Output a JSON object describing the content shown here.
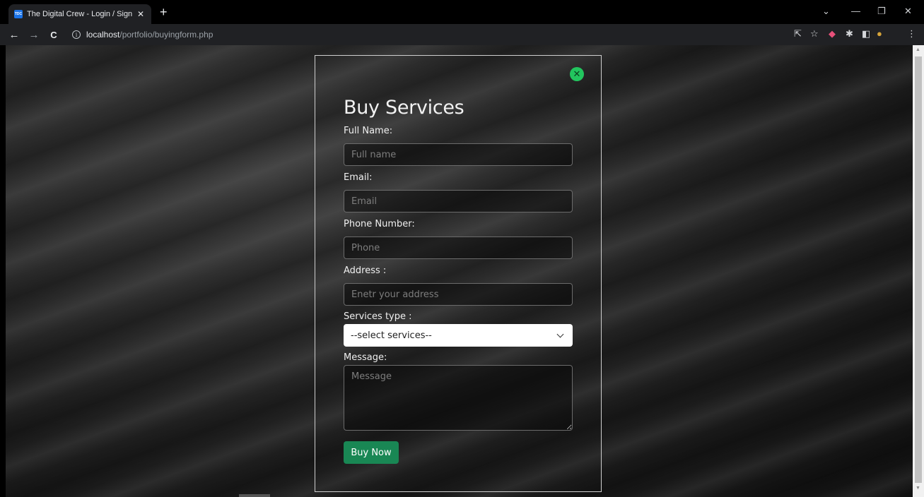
{
  "browser": {
    "tab_title": "The Digital Crew - Login / Sign up",
    "tab_favicon_text": "TDC",
    "tab_close": "✕",
    "new_tab": "+",
    "url_host": "localhost",
    "url_path": "/portfolio/buyingform.php",
    "window_controls": {
      "dropdown": "⌄",
      "minimize": "—",
      "restore": "❐",
      "close": "✕"
    },
    "nav": {
      "back": "←",
      "forward": "→",
      "reload": "C"
    },
    "toolbar_icons": {
      "share": "⇱",
      "bookmark": "☆",
      "extension": "◆",
      "extensions_menu": "✱",
      "sidepanel": "◧",
      "profile": "●",
      "menu": "⋮"
    }
  },
  "form": {
    "close_icon": "✕",
    "title": "Buy Services",
    "full_name": {
      "label": "Full Name:",
      "placeholder": "Full name"
    },
    "email": {
      "label": "Email:",
      "placeholder": "Email"
    },
    "phone": {
      "label": "Phone Number:",
      "placeholder": "Phone"
    },
    "address": {
      "label": "Address :",
      "placeholder": "Enetr your address"
    },
    "services": {
      "label": "Services type :",
      "selected": "--select services--"
    },
    "message": {
      "label": "Message:",
      "placeholder": "Message"
    },
    "submit_label": "Buy Now"
  },
  "colors": {
    "accent_green": "#198754",
    "close_green": "#22c55e",
    "panel_border": "#cfcfcf"
  }
}
